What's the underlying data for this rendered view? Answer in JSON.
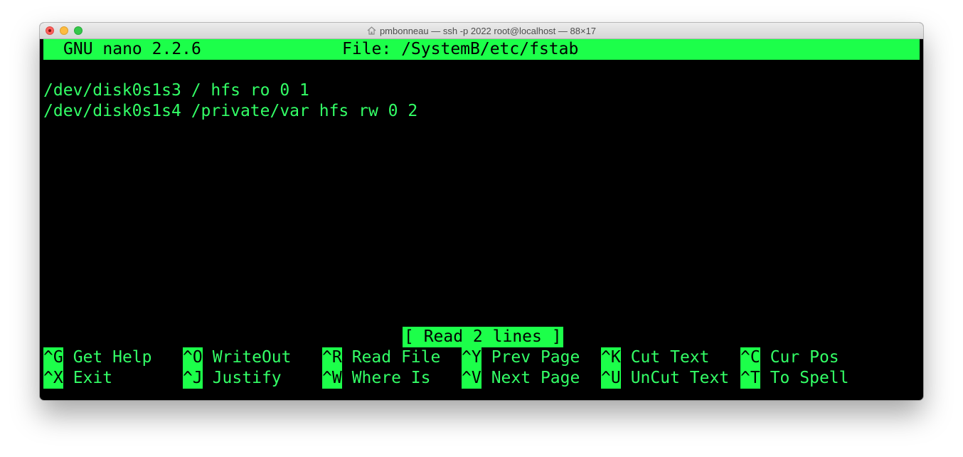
{
  "window": {
    "title": "pmbonneau — ssh -p 2022 root@localhost — 88×17"
  },
  "nano": {
    "version_label": "GNU nano 2.2.6",
    "file_label": "File: /SystemB/etc/fstab"
  },
  "file_lines": [
    "/dev/disk0s1s3 / hfs ro 0 1",
    "/dev/disk0s1s4 /private/var hfs rw 0 2"
  ],
  "status": "[ Read 2 lines ]",
  "shortcuts": {
    "row1": [
      {
        "key": "^G",
        "label": "Get Help"
      },
      {
        "key": "^O",
        "label": "WriteOut"
      },
      {
        "key": "^R",
        "label": "Read File"
      },
      {
        "key": "^Y",
        "label": "Prev Page"
      },
      {
        "key": "^K",
        "label": "Cut Text"
      },
      {
        "key": "^C",
        "label": "Cur Pos"
      }
    ],
    "row2": [
      {
        "key": "^X",
        "label": "Exit"
      },
      {
        "key": "^J",
        "label": "Justify"
      },
      {
        "key": "^W",
        "label": "Where Is"
      },
      {
        "key": "^V",
        "label": "Next Page"
      },
      {
        "key": "^U",
        "label": "UnCut Text"
      },
      {
        "key": "^T",
        "label": "To Spell"
      }
    ]
  },
  "colors": {
    "terminal_bg": "#000000",
    "terminal_fg": "#33ff66",
    "highlight_bg": "#1cff4a"
  },
  "icons": [
    "close-button",
    "minimize-button",
    "zoom-button",
    "home-icon"
  ]
}
